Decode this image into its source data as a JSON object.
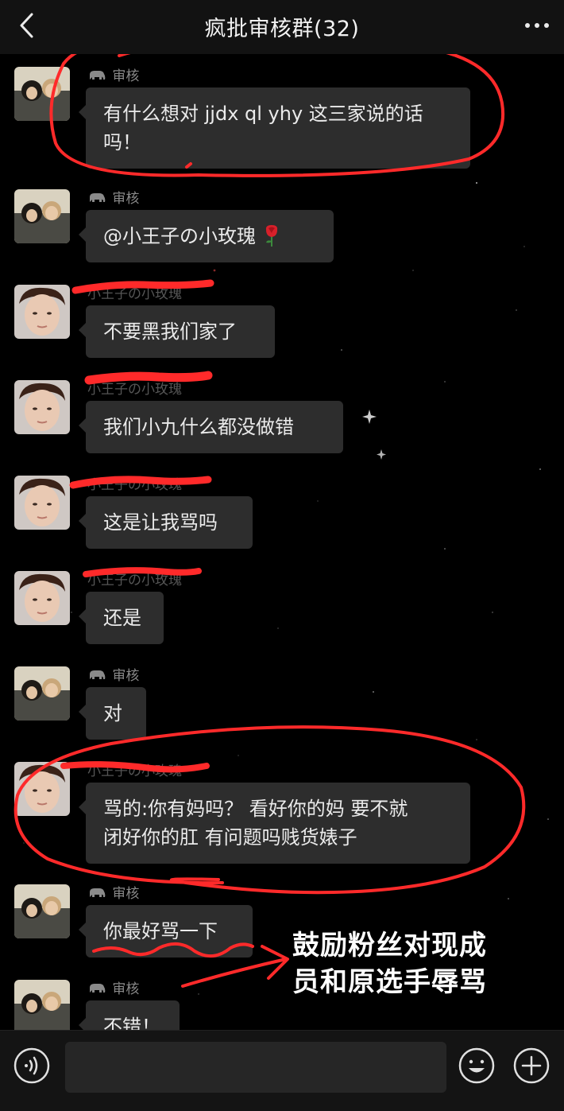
{
  "header": {
    "title": "疯批审核群(32)",
    "back_icon": "chevron-left-icon",
    "more_icon": "ellipsis-icon"
  },
  "messages": [
    {
      "sender": "审核",
      "sender_badge": "elephant-icon",
      "avatar": "group-photo-avatar",
      "lines": [
        "有什么想对 jjdx ql yhy 这三家说的话",
        "吗！"
      ],
      "emoji": ""
    },
    {
      "sender": "审核",
      "sender_badge": "elephant-icon",
      "avatar": "group-photo-avatar",
      "lines": [
        "@小王子の小玫瑰"
      ],
      "emoji": "rose-icon"
    },
    {
      "sender": "小王子の小玫瑰",
      "sender_badge": "",
      "sender_redacted": true,
      "avatar": "selfie-avatar",
      "lines": [
        "不要黑我们家了"
      ],
      "emoji": ""
    },
    {
      "sender": "小王子の小玫瑰",
      "sender_badge": "",
      "sender_redacted": true,
      "avatar": "selfie-avatar",
      "lines": [
        "我们小九什么都没做错"
      ],
      "emoji": ""
    },
    {
      "sender": "小王子の小玫瑰",
      "sender_badge": "",
      "sender_redacted": true,
      "avatar": "selfie-avatar",
      "lines": [
        "这是让我骂吗"
      ],
      "emoji": ""
    },
    {
      "sender": "小王子の小玫瑰",
      "sender_badge": "",
      "sender_redacted": true,
      "avatar": "selfie-avatar",
      "lines": [
        "还是"
      ],
      "emoji": ""
    },
    {
      "sender": "审核",
      "sender_badge": "elephant-icon",
      "avatar": "group-photo-avatar",
      "lines": [
        "对"
      ],
      "emoji": ""
    },
    {
      "sender": "小王子の小玫瑰",
      "sender_badge": "",
      "sender_redacted": true,
      "avatar": "selfie-avatar",
      "lines": [
        "骂的:你有妈吗？ 看好你的妈 要不就",
        "闭好你的肛 有问题吗贱货婊子"
      ],
      "emoji": ""
    },
    {
      "sender": "审核",
      "sender_badge": "elephant-icon",
      "avatar": "group-photo-avatar",
      "lines": [
        "你最好骂一下"
      ],
      "emoji": ""
    },
    {
      "sender": "审核",
      "sender_badge": "elephant-icon",
      "avatar": "group-photo-avatar",
      "lines": [
        "不错！"
      ],
      "emoji": ""
    }
  ],
  "annotation": {
    "lines": [
      "鼓励粉丝对现成",
      "员和原选手辱骂"
    ],
    "color": "#ff2a2a"
  },
  "input_bar": {
    "voice_icon": "voice-icon",
    "emoji_icon": "emoji-icon",
    "plus_icon": "plus-icon",
    "input_value": ""
  },
  "colors": {
    "background": "#000000",
    "bubble": "#2d2d2d",
    "header": "#121212",
    "annotation_red": "#ff2a2a"
  }
}
